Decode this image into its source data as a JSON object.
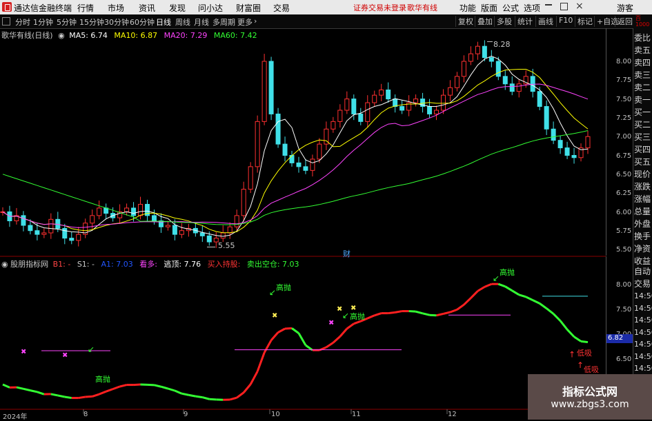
{
  "app": {
    "title": "通达信金融终端",
    "menu": [
      "行情",
      "市场",
      "资讯",
      "发现",
      "问小达",
      "财富圈",
      "交易"
    ],
    "login_notice": "证券交易未登录",
    "stock_name": "歌华有线",
    "right_menu": [
      "功能",
      "版面",
      "公式",
      "选项"
    ],
    "guest": "游客"
  },
  "periods": [
    "分时",
    "1分钟",
    "5分钟",
    "15分钟",
    "30分钟",
    "60分钟",
    "日线",
    "周线",
    "月线",
    "多周期",
    "更多"
  ],
  "active_period": "日线",
  "toolbar_right": [
    "复权",
    "叠加",
    "多股",
    "统计",
    "画线",
    "F10",
    "标记",
    "+自选",
    "返回"
  ],
  "main_chart": {
    "title": "歌华有线(日线)",
    "ma": [
      {
        "label": "MA5: 6.74",
        "color": "#ffffff"
      },
      {
        "label": "MA10: 6.87",
        "color": "#ffff00"
      },
      {
        "label": "MA20: 7.29",
        "color": "#ff44ff"
      },
      {
        "label": "MA60: 7.42",
        "color": "#33ff33"
      }
    ],
    "high_label": "8.28",
    "low_label": "5.55",
    "event_label": "财",
    "axis_ticks": [
      "8.00",
      "7.75",
      "7.50",
      "7.25",
      "7.00",
      "6.75",
      "6.50",
      "6.25",
      "6.00",
      "5.75",
      "5.50"
    ]
  },
  "sub_chart": {
    "title": "股朋指标网",
    "legend": [
      {
        "label": "B1: -",
        "color": "#ff4444"
      },
      {
        "label": "S1: -",
        "color": "#c8c8c8"
      },
      {
        "label": "A1: 7.03",
        "color": "#2255ff"
      },
      {
        "label": "看多:",
        "color": "#ff44ff"
      },
      {
        "label": "逃顶: 7.76",
        "color": "#ffffff"
      },
      {
        "label": "买入持股:",
        "color": "#ff3333"
      },
      {
        "label": "卖出空仓: 7.03",
        "color": "#33ff33"
      }
    ],
    "axis_ticks": [
      "8.00",
      "7.50",
      "7.00",
      "6.50"
    ],
    "current_value": "6.82",
    "annotations": {
      "gaopao": "高抛",
      "dixi": "低吸"
    }
  },
  "side_panel": {
    "top_items": [
      "委比",
      "卖五",
      "卖四",
      "卖三",
      "卖二",
      "卖一",
      "买一",
      "买二",
      "买三",
      "买四",
      "买五",
      "现价",
      "涨跌",
      "涨幅",
      "总量",
      "外盘",
      "换手",
      "净资",
      "收益"
    ],
    "mid_items": [
      "自动",
      "交易"
    ],
    "times": [
      "14:56",
      "14:56",
      "14:56",
      "14:56",
      "14:56",
      "14:56",
      "14:56",
      "14:56",
      "14:56",
      "14:56"
    ],
    "top_tag": "百 1000"
  },
  "dates": [
    "2024年",
    "8",
    "9",
    "10",
    "11",
    "12"
  ],
  "watermark": {
    "title": "指标公式网",
    "url": "www.zbgs3.com"
  },
  "chart_data": {
    "type": "candlestick",
    "title": "歌华有线(日线)",
    "price_axis_ticks": [
      8.0,
      7.75,
      7.5,
      7.25,
      7.0,
      6.75,
      6.5,
      6.25,
      6.0,
      5.75,
      5.5
    ],
    "ylim": [
      5.45,
      8.35
    ],
    "annotated_high": 8.28,
    "annotated_low": 5.55,
    "ma_values": {
      "MA5": 6.74,
      "MA10": 6.87,
      "MA20": 7.29,
      "MA60": 7.42
    },
    "sub_values": {
      "A1": 7.03,
      "逃顶": 7.76,
      "卖出空仓": 7.03,
      "current": 6.82
    },
    "x_labels": [
      "2024年",
      "8",
      "9",
      "10",
      "11",
      "12"
    ],
    "closes": [
      6.0,
      5.88,
      5.95,
      5.82,
      5.75,
      5.7,
      5.72,
      5.9,
      5.78,
      5.65,
      5.62,
      5.7,
      5.85,
      5.95,
      6.05,
      5.98,
      5.92,
      6.0,
      6.05,
      5.95,
      6.1,
      5.95,
      5.88,
      5.8,
      5.82,
      5.7,
      5.75,
      5.78,
      5.72,
      5.68,
      5.6,
      5.65,
      5.72,
      5.8,
      5.95,
      6.3,
      6.6,
      7.2,
      8.0,
      7.3,
      6.9,
      6.75,
      6.65,
      6.6,
      6.55,
      6.7,
      6.9,
      7.1,
      7.2,
      7.35,
      7.5,
      7.3,
      7.2,
      7.45,
      7.55,
      7.62,
      7.5,
      7.4,
      7.35,
      7.45,
      7.5,
      7.4,
      7.3,
      7.35,
      7.55,
      7.65,
      7.8,
      8.0,
      8.1,
      8.2,
      8.05,
      8.0,
      7.8,
      7.7,
      7.6,
      7.7,
      7.8,
      7.6,
      7.4,
      7.1,
      6.95,
      6.85,
      6.75,
      6.72,
      6.85,
      7.0
    ]
  }
}
